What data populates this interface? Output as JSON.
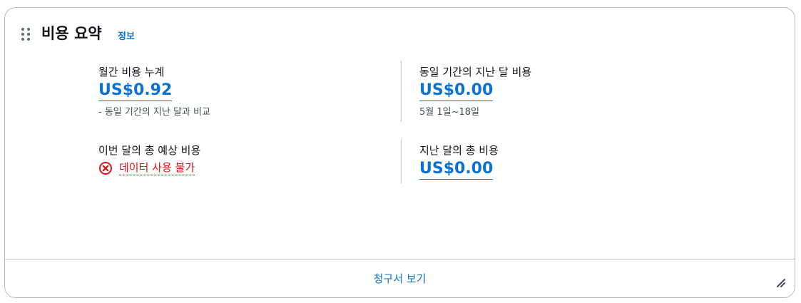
{
  "header": {
    "title": "비용 요약",
    "info_link": "정보"
  },
  "metrics": {
    "mtd": {
      "label": "월간 비용 누계",
      "value": "US$0.92",
      "sub": "- 동일 기간의 지난 달과 비교"
    },
    "last_month_same_period": {
      "label": "동일 기간의 지난 달 비용",
      "value": "US$0.00",
      "sub": "5월 1일~18일"
    },
    "forecast": {
      "label": "이번 달의 총 예상 비용",
      "error": "데이터 사용 불가",
      "icon": "error-circle-icon"
    },
    "last_month_total": {
      "label": "지난 달의 총 비용",
      "value": "US$0.00"
    }
  },
  "footer": {
    "link": "청구서 보기"
  },
  "colors": {
    "link": "#0972d3",
    "error": "#d91515",
    "border": "#b6bec9"
  }
}
